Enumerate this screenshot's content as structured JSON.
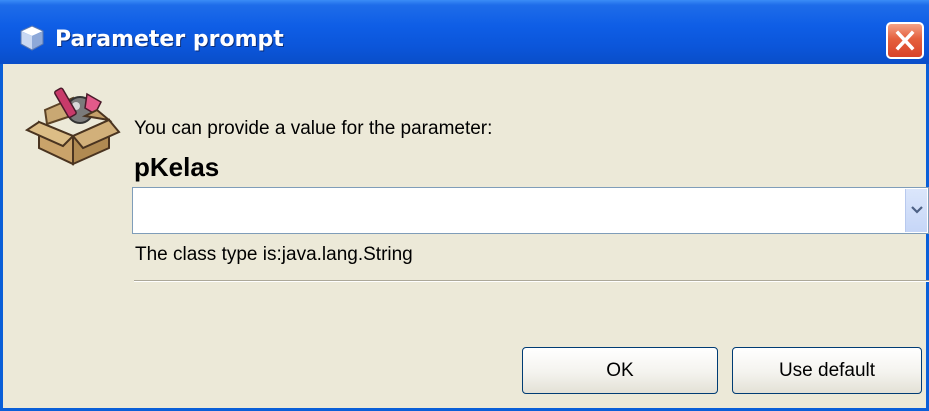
{
  "window": {
    "title": "Parameter prompt",
    "icons": {
      "title": "cube-icon",
      "close": "close-icon",
      "content": "open-box-icon"
    }
  },
  "dialog": {
    "prompt": "You can provide a value for the parameter:",
    "parameter_name": "pKelas",
    "value": "",
    "class_type": "The class type is:java.lang.String"
  },
  "buttons": {
    "ok": "OK",
    "use_default": "Use default"
  },
  "colors": {
    "titlebar": "#0b55d9",
    "window_bg": "#ece9d8",
    "close_button": "#d8432a"
  }
}
